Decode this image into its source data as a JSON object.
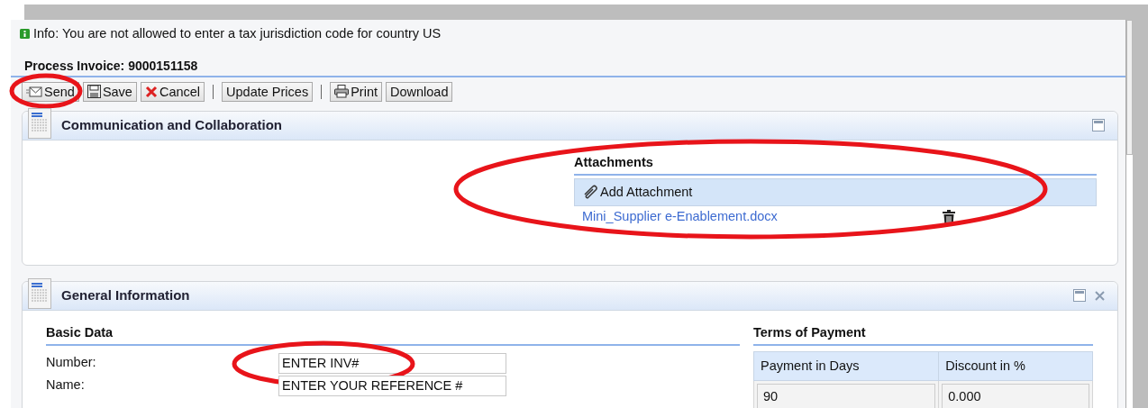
{
  "info_message": {
    "text": "Info: You are not allowed to enter a tax jurisdiction code for country US"
  },
  "page_title": "Process Invoice: 9000151158",
  "toolbar": [
    {
      "kind": "button",
      "label": "Send"
    },
    {
      "kind": "button",
      "label": "Save"
    },
    {
      "kind": "button",
      "label": "Cancel"
    },
    {
      "kind": "separator"
    },
    {
      "kind": "button",
      "label": "Update Prices"
    },
    {
      "kind": "separator"
    },
    {
      "kind": "button",
      "label": "Print"
    },
    {
      "kind": "button",
      "label": "Download"
    }
  ],
  "communication_panel": {
    "title": "Communication and Collaboration",
    "closable": false,
    "attachments": {
      "heading": "Attachments",
      "add_label": "Add Attachment",
      "files": [
        {
          "name": "Mini_Supplier e-Enablement.docx"
        }
      ]
    }
  },
  "general_panel": {
    "title": "General Information",
    "closable": true,
    "basic_data": {
      "heading": "Basic Data",
      "fields": [
        {
          "label": "Number:",
          "value": "ENTER INV#"
        },
        {
          "label": "Name:",
          "value": "ENTER YOUR REFERENCE #"
        }
      ]
    },
    "terms_of_payment": {
      "heading": "Terms of Payment",
      "columns": [
        "Payment in Days",
        "Discount in %"
      ],
      "rows": [
        [
          "90",
          "0.000"
        ]
      ]
    }
  },
  "highlights": [
    {
      "kind": "ellipse"
    },
    {
      "kind": "ellipse"
    },
    {
      "kind": "ellipse"
    }
  ]
}
